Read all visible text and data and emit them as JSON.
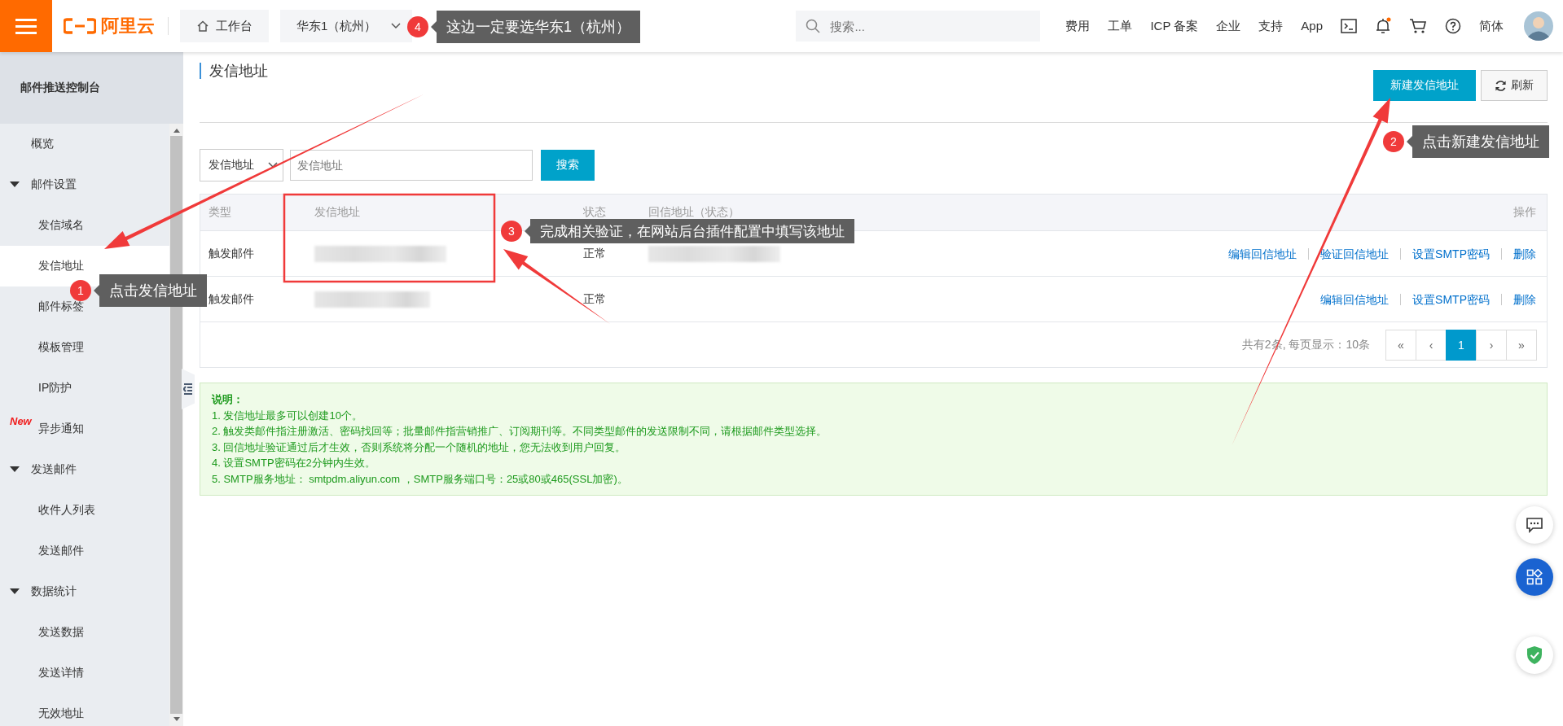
{
  "top_bar": {
    "logo": "阿里云",
    "workbench": "工作台",
    "region": "华东1（杭州）",
    "search": {
      "placeholder": "搜索..."
    },
    "links": [
      "费用",
      "工单",
      "ICP 备案",
      "企业",
      "支持",
      "App"
    ],
    "notification_dot": true,
    "language": "简体"
  },
  "sidebar": {
    "title": "邮件推送控制台",
    "items": [
      {
        "label": "概览",
        "kind": "item",
        "selected": false
      },
      {
        "label": "邮件设置",
        "kind": "group",
        "expanded": true,
        "children": [
          {
            "label": "发信域名",
            "selected": false
          },
          {
            "label": "发信地址",
            "selected": true
          },
          {
            "label": "邮件标签",
            "selected": false
          },
          {
            "label": "模板管理",
            "selected": false
          },
          {
            "label": "IP防护",
            "selected": false
          },
          {
            "label": "异步通知",
            "selected": false,
            "badge": "New"
          }
        ]
      },
      {
        "label": "发送邮件",
        "kind": "group",
        "expanded": true,
        "children": [
          {
            "label": "收件人列表",
            "selected": false
          },
          {
            "label": "发送邮件",
            "selected": false
          }
        ]
      },
      {
        "label": "数据统计",
        "kind": "group",
        "expanded": true,
        "children": [
          {
            "label": "发送数据",
            "selected": false
          },
          {
            "label": "发送详情",
            "selected": false
          },
          {
            "label": "无效地址",
            "selected": false
          }
        ]
      }
    ]
  },
  "page": {
    "title": "发信地址",
    "buttons": [
      {
        "label": "新建发信地址",
        "kind": "primary"
      },
      {
        "label": "刷新",
        "kind": "refresh"
      }
    ]
  },
  "filter": {
    "select": "发信地址",
    "placeholder": "发信地址",
    "button": "搜索"
  },
  "table": {
    "columns": [
      "类型",
      "发信地址",
      "状态",
      "回信地址（状态）",
      "操作"
    ],
    "rows": [
      {
        "type": "触发邮件",
        "address_blurred": true,
        "status": "正常",
        "reply_blurred": true,
        "actions": [
          "编辑回信地址",
          "验证回信地址",
          "设置SMTP密码",
          "删除"
        ]
      },
      {
        "type": "触发邮件",
        "address_blurred": true,
        "status": "正常",
        "reply_blurred": false,
        "actions": [
          "编辑回信地址",
          "设置SMTP密码",
          "删除"
        ]
      }
    ]
  },
  "pagination": {
    "summary": "共有2条, 每页显示：10条",
    "pages": [
      {
        "label": "«",
        "selected": false
      },
      {
        "label": "‹",
        "selected": false
      },
      {
        "label": "1",
        "selected": true
      },
      {
        "label": "›",
        "selected": false
      },
      {
        "label": "»",
        "selected": false
      }
    ]
  },
  "notes": {
    "title": "说明：",
    "lines": [
      "1. 发信地址最多可以创建10个。",
      "2. 触发类邮件指注册激活、密码找回等；批量邮件指营销推广、订阅期刊等。不同类型邮件的发送限制不同，请根据邮件类型选择。",
      "3. 回信地址验证通过后才生效，否则系统将分配一个随机的地址，您无法收到用户回复。",
      "4. 设置SMTP密码在2分钟内生效。",
      "5. SMTP服务地址： smtpdm.aliyun.com ，SMTP服务端口号：25或80或465(SSL加密)。"
    ]
  },
  "callouts": [
    {
      "number": "4",
      "text": "这边一定要选华东1（杭州）"
    },
    {
      "number": "2",
      "text": "点击新建发信地址"
    },
    {
      "number": "3",
      "text": "完成相关验证，在网站后台插件配置中填写该地址"
    },
    {
      "number": "1",
      "text": "点击发信地址"
    }
  ]
}
